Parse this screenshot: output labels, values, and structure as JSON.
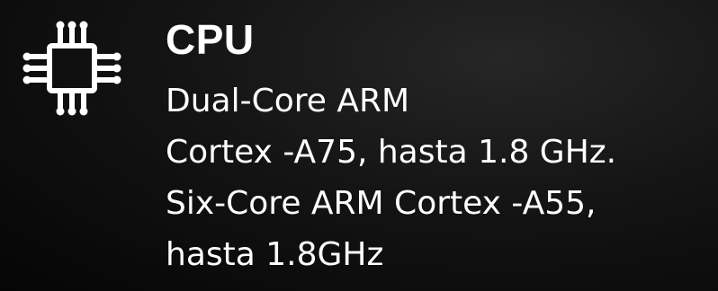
{
  "spec": {
    "icon": "cpu-chip-icon",
    "title": "CPU",
    "lines": [
      "Dual-Core ARM",
      "Cortex -A75, hasta 1.8 GHz.",
      "Six-Core ARM Cortex -A55,",
      "hasta 1.8GHz"
    ]
  },
  "colors": {
    "background": "#0b0b0b",
    "text": "#ffffff"
  }
}
